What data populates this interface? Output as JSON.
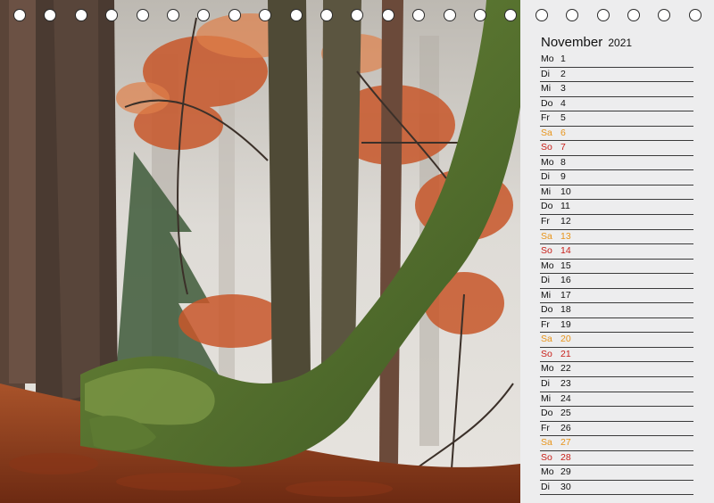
{
  "calendar": {
    "month": "November",
    "year": "2021",
    "days": [
      {
        "wd": "Mo",
        "num": "1",
        "type": "weekday"
      },
      {
        "wd": "Di",
        "num": "2",
        "type": "weekday"
      },
      {
        "wd": "Mi",
        "num": "3",
        "type": "weekday"
      },
      {
        "wd": "Do",
        "num": "4",
        "type": "weekday"
      },
      {
        "wd": "Fr",
        "num": "5",
        "type": "weekday"
      },
      {
        "wd": "Sa",
        "num": "6",
        "type": "saturday"
      },
      {
        "wd": "So",
        "num": "7",
        "type": "sunday"
      },
      {
        "wd": "Mo",
        "num": "8",
        "type": "weekday"
      },
      {
        "wd": "Di",
        "num": "9",
        "type": "weekday"
      },
      {
        "wd": "Mi",
        "num": "10",
        "type": "weekday"
      },
      {
        "wd": "Do",
        "num": "11",
        "type": "weekday"
      },
      {
        "wd": "Fr",
        "num": "12",
        "type": "weekday"
      },
      {
        "wd": "Sa",
        "num": "13",
        "type": "saturday"
      },
      {
        "wd": "So",
        "num": "14",
        "type": "sunday"
      },
      {
        "wd": "Mo",
        "num": "15",
        "type": "weekday"
      },
      {
        "wd": "Di",
        "num": "16",
        "type": "weekday"
      },
      {
        "wd": "Mi",
        "num": "17",
        "type": "weekday"
      },
      {
        "wd": "Do",
        "num": "18",
        "type": "weekday"
      },
      {
        "wd": "Fr",
        "num": "19",
        "type": "weekday"
      },
      {
        "wd": "Sa",
        "num": "20",
        "type": "saturday"
      },
      {
        "wd": "So",
        "num": "21",
        "type": "sunday"
      },
      {
        "wd": "Mo",
        "num": "22",
        "type": "weekday"
      },
      {
        "wd": "Di",
        "num": "23",
        "type": "weekday"
      },
      {
        "wd": "Mi",
        "num": "24",
        "type": "weekday"
      },
      {
        "wd": "Do",
        "num": "25",
        "type": "weekday"
      },
      {
        "wd": "Fr",
        "num": "26",
        "type": "weekday"
      },
      {
        "wd": "Sa",
        "num": "27",
        "type": "saturday"
      },
      {
        "wd": "So",
        "num": "28",
        "type": "sunday"
      },
      {
        "wd": "Mo",
        "num": "29",
        "type": "weekday"
      },
      {
        "wd": "Di",
        "num": "30",
        "type": "weekday"
      }
    ]
  },
  "binding": {
    "ring_count": 23,
    "icon": "binding-ring-icon"
  },
  "colors": {
    "saturday": "#e8941a",
    "sunday": "#c8201a",
    "panel_background": "#ededee"
  },
  "photo": {
    "subject": "autumn forest with moss-covered tree trunk and red beech leaves"
  }
}
